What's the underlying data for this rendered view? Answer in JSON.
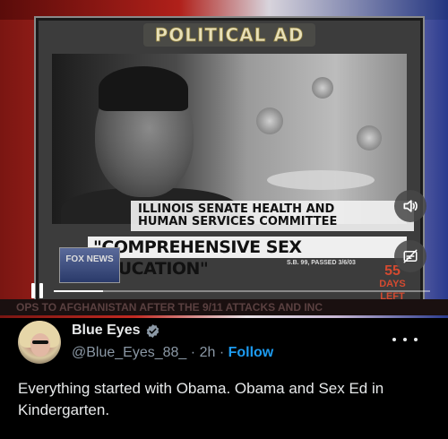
{
  "video": {
    "banner": "POLITICAL AD",
    "caption_line1": "ILLINOIS SENATE HEALTH AND",
    "caption_line2": "HUMAN SERVICES COMMITTEE",
    "headline": "\"COMPREHENSIVE SEX EDUCATION\"",
    "bill_info": "S.B. 99, PASSED 3/6/03",
    "network_logo": "FOX NEWS",
    "days_number": "55",
    "days_label": "DAYS LEFT",
    "ticker": "OPS TO AFGHANISTAN AFTER THE 9/11 ATTACKS AND INC",
    "progress_fraction": 0.13,
    "state": "playing"
  },
  "tweet": {
    "display_name": "Blue Eyes",
    "handle": "@Blue_Eyes_88_",
    "separator": "·",
    "time": "2h",
    "follow_label": "Follow",
    "text": "Everything started with Obama. Obama and Sex Ed in Kindergarten."
  },
  "icons": {
    "volume": "volume-icon",
    "captions": "captions-icon",
    "pause": "pause-icon",
    "verified": "verified-badge-icon",
    "more": "more-options-icon"
  },
  "colors": {
    "background": "#000000",
    "text": "#e7e9ea",
    "muted": "#8b98a5",
    "accent": "#1d9bf0",
    "verified_badge": "#8b98a5"
  }
}
